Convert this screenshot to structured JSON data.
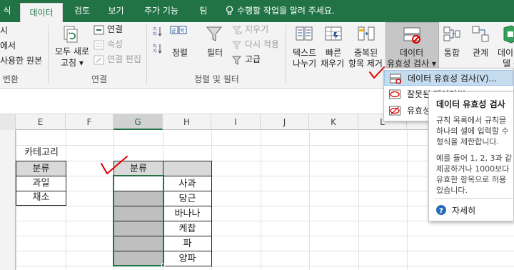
{
  "colors": {
    "ribbon_green": "#217346",
    "annotation_red": "#e00000",
    "highlight_blue": "#c5dcef"
  },
  "tabs": [
    {
      "label": "식",
      "active": false
    },
    {
      "label": "데이터",
      "active": true
    },
    {
      "label": "검토",
      "active": false
    },
    {
      "label": "보기",
      "active": false
    },
    {
      "label": "추가 기능",
      "active": false
    },
    {
      "label": "팀",
      "active": false
    }
  ],
  "tell_me": "수행할 작업을 알려 주세요.",
  "ribbon": {
    "get_transform": {
      "items": [
        "시",
        "에서",
        "사용한 원본"
      ],
      "group_label": "변환"
    },
    "connections": {
      "refresh_all": [
        "모두 새로",
        "고침 ▾"
      ],
      "connections": "연결",
      "properties": "속성",
      "edit_links": "연결 편집",
      "group_label": "연결"
    },
    "sort_filter": {
      "sort": "정렬",
      "filter": "필터",
      "clear": "지우기",
      "reapply": "다시 적용",
      "advanced": "고급",
      "group_label": "정렬 및 필터"
    },
    "data_tools": {
      "text_to_columns": [
        "텍스트",
        "나누기"
      ],
      "flash_fill": [
        "빠른",
        "채우기"
      ],
      "remove_duplicates": [
        "중복된",
        "항목 제거"
      ],
      "data_validation": [
        "데이터",
        "유효성 검사 ▾"
      ],
      "consolidate": "통합",
      "relationships": "관계",
      "data_model": [
        "데이터",
        "델 관"
      ]
    }
  },
  "sheet": {
    "columns": [
      "E",
      "F",
      "G",
      "H",
      "I",
      "J",
      "K",
      "L"
    ],
    "category_title": "카테고리",
    "category_header": "분류",
    "categories": [
      "과일",
      "채소"
    ],
    "list_header": "분류",
    "items": [
      "사과",
      "당근",
      "바나나",
      "케찹",
      "파",
      "양파"
    ]
  },
  "menu": {
    "items": [
      {
        "label": "데이터 유효성 검사(V)...",
        "highlighted": true
      },
      {
        "label": "잘못된 데이터(I)",
        "highlighted": false
      },
      {
        "label": "유효성",
        "highlighted": false
      }
    ]
  },
  "tooltip": {
    "title": "데이터 유효성 검사",
    "body1": "규칙 목록에서 규칙을\n하나의 셀에 입력할 수\n형식을 제한합니다.",
    "body2": "예를 들어 1, 2, 3과 같\n제공하거나 1000보다\n유효한 항목으로 허용\n있습니다.",
    "more": "자세히"
  }
}
